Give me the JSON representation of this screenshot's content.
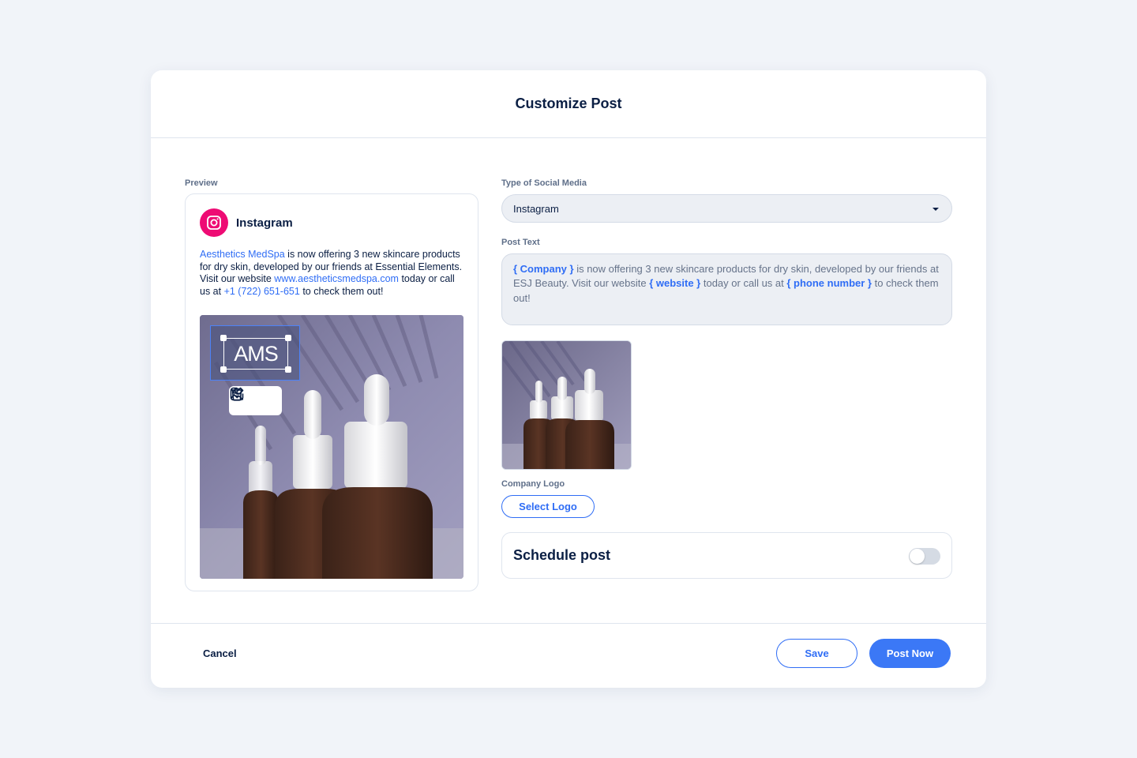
{
  "modal": {
    "title": "Customize Post"
  },
  "preview": {
    "label": "Preview",
    "platform_name": "Instagram",
    "text": {
      "company": "Aesthetics MedSpa",
      "part1": " is now offering 3 new skincare products for dry skin, developed by our friends at Essential Elements. Visit our website ",
      "website": "www.aestheticsmedspa.com",
      "part2": " today or call us at ",
      "phone": "+1 (722) 651-651",
      "part3": " to check them out!"
    },
    "logo_text": "AMS"
  },
  "form": {
    "social_label": "Type of Social Media",
    "social_value": "Instagram",
    "post_text_label": "Post Text",
    "post_text": {
      "var_company": "{ Company }",
      "part1": " is now offering 3 new skincare products for dry skin, developed by our friends at ESJ Beauty. Visit our website ",
      "var_website": "{ website }",
      "part2": " today or call us at ",
      "var_phone": "{ phone number }",
      "part3": " to check them out!"
    },
    "company_logo_label": "Company Logo",
    "select_logo_label": "Select Logo",
    "schedule_label": "Schedule post",
    "schedule_enabled": false
  },
  "footer": {
    "cancel_label": "Cancel",
    "save_label": "Save",
    "post_now_label": "Post Now"
  },
  "colors": {
    "accent": "#2f6df5",
    "instagram": "#ee0b74",
    "bottle": "#4a2a1c"
  },
  "icons": [
    "instagram-icon",
    "edit-image-icon",
    "trash-icon",
    "dropdown-caret-icon"
  ]
}
